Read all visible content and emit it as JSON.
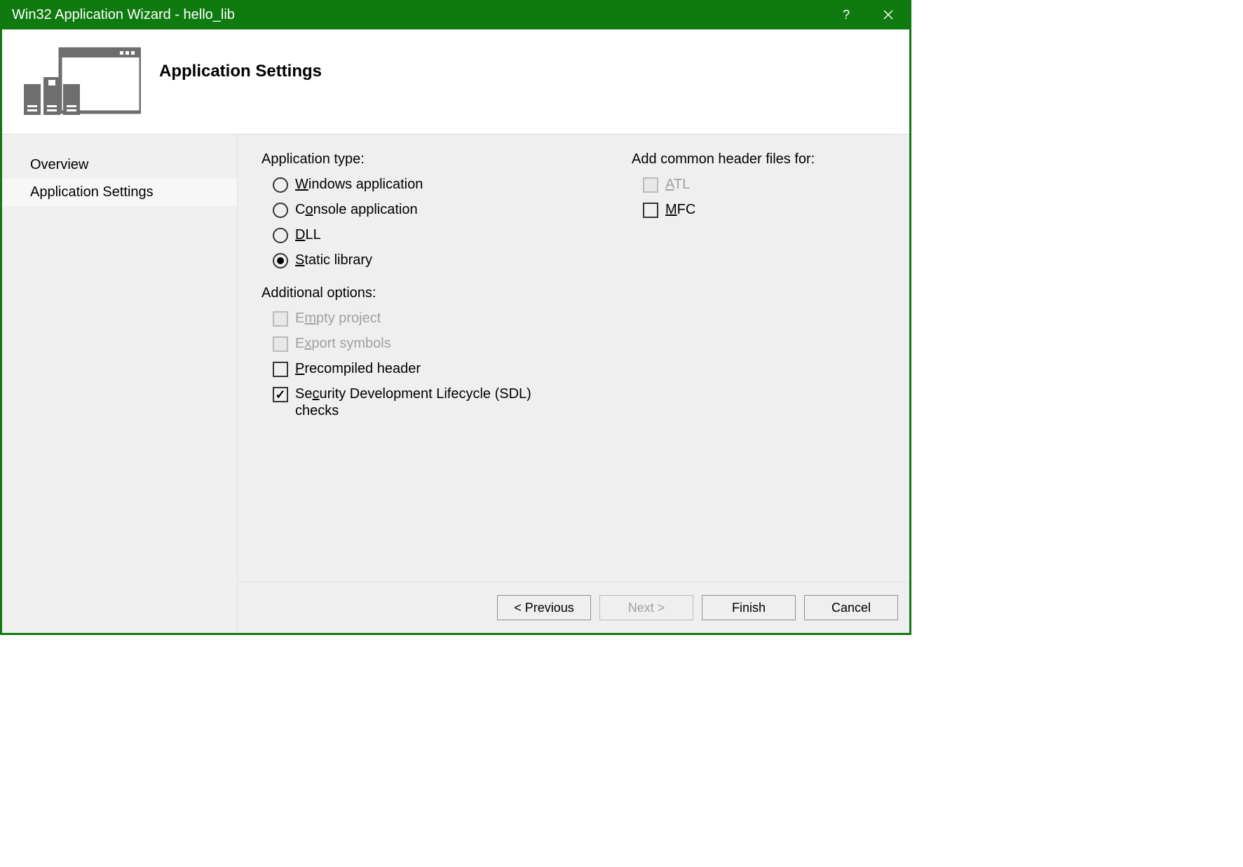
{
  "titlebar": {
    "title": "Win32 Application Wizard - hello_lib"
  },
  "header": {
    "heading": "Application Settings"
  },
  "sidebar": {
    "items": [
      {
        "label": "Overview",
        "selected": false
      },
      {
        "label": "Application Settings",
        "selected": true
      }
    ]
  },
  "content": {
    "app_type_label": "Application type:",
    "app_types": [
      {
        "prefix": "W",
        "rest": "indows application",
        "checked": false
      },
      {
        "prefix": "C",
        "mid": "o",
        "rest": "nsole application",
        "pretext": "C",
        "checked": false
      },
      {
        "prefix": "D",
        "rest": "LL",
        "checked": false
      },
      {
        "prefix": "S",
        "rest": "tatic library",
        "checked": true
      }
    ],
    "additional_label": "Additional options:",
    "additional": [
      {
        "prefix": "E",
        "mid": "m",
        "rest": "pty project",
        "checked": false,
        "disabled": true,
        "pretext": "E"
      },
      {
        "prefix": "E",
        "mid": "x",
        "rest": "port symbols",
        "checked": false,
        "disabled": true,
        "pretext": "E"
      },
      {
        "prefix": "P",
        "rest": "recompiled header",
        "checked": false,
        "disabled": false
      },
      {
        "prefix": "Se",
        "mid": "c",
        "rest": "urity Development Lifecycle (SDL) checks",
        "checked": true,
        "disabled": false,
        "pretext": "Se"
      }
    ],
    "header_files_label": "Add common header files for:",
    "header_files": [
      {
        "prefix": "A",
        "rest": "TL",
        "checked": false,
        "disabled": true
      },
      {
        "prefix": "M",
        "rest": "FC",
        "checked": false,
        "disabled": false
      }
    ]
  },
  "footer": {
    "previous": "< Previous",
    "next": "Next >",
    "finish": "Finish",
    "cancel": "Cancel"
  }
}
